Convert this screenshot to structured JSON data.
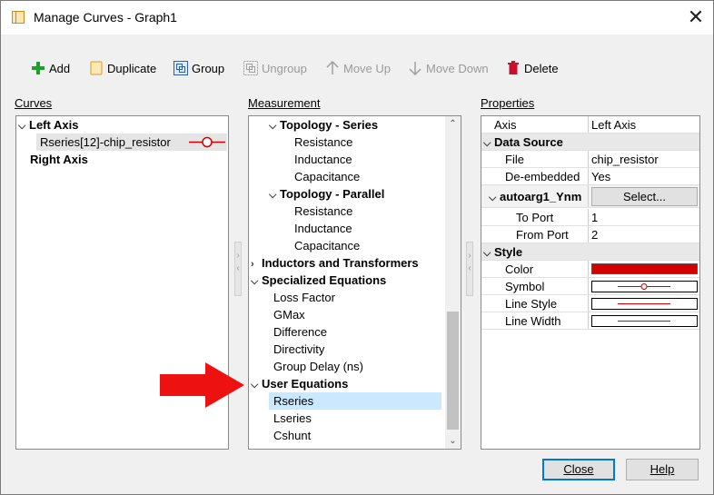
{
  "window": {
    "title": "Manage Curves - Graph1"
  },
  "toolbar": {
    "add": "Add",
    "duplicate": "Duplicate",
    "group": "Group",
    "ungroup": "Ungroup",
    "move_up": "Move Up",
    "move_down": "Move Down",
    "delete": "Delete"
  },
  "curves": {
    "label": "Curves",
    "left_axis": "Left Axis",
    "item": "Rseries[12]-chip_resistor",
    "right_axis": "Right Axis"
  },
  "measurement": {
    "label": "Measurement",
    "topology_series": "Topology - Series",
    "series_items": [
      "Resistance",
      "Inductance",
      "Capacitance"
    ],
    "topology_parallel": "Topology - Parallel",
    "parallel_items": [
      "Resistance",
      "Inductance",
      "Capacitance"
    ],
    "inductors": "Inductors and Transformers",
    "specialized": "Specialized Equations",
    "specialized_items": [
      "Loss Factor",
      "GMax",
      "Difference",
      "Directivity",
      "Group Delay (ns)"
    ],
    "user_equations": "User Equations",
    "user_items": [
      "Rseries",
      "Lseries",
      "Cshunt"
    ]
  },
  "properties": {
    "label": "Properties",
    "axis_key": "Axis",
    "axis_val": "Left Axis",
    "data_source": "Data Source",
    "file_key": "File",
    "file_val": "chip_resistor",
    "deembedded_key": "De-embedded",
    "deembedded_val": "Yes",
    "autoarg_key": "autoarg1_Ynm",
    "autoarg_btn": "Select...",
    "to_port_key": "To Port",
    "to_port_val": "1",
    "from_port_key": "From Port",
    "from_port_val": "2",
    "style": "Style",
    "color_key": "Color",
    "symbol_key": "Symbol",
    "line_style_key": "Line Style",
    "line_width_key": "Line Width",
    "curve_color": "#d40000"
  },
  "buttons": {
    "close": "Close",
    "help": "Help"
  }
}
